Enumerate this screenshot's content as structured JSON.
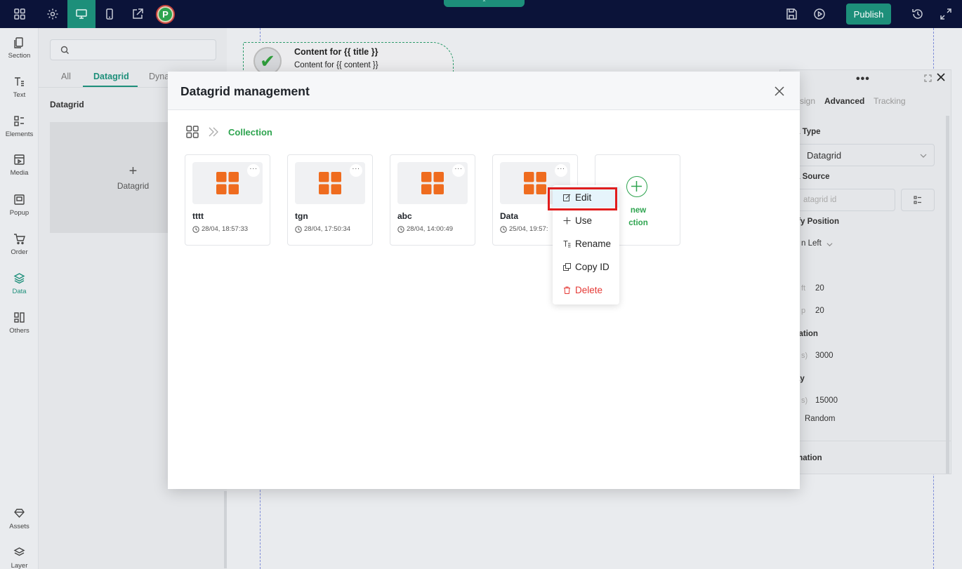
{
  "topbar": {
    "avatar_letter": "P",
    "publish_label": "Publish",
    "icons": [
      "apps-grid-icon",
      "gear-icon",
      "monitor-icon",
      "mobile-icon",
      "share-icon",
      "save-icon",
      "play-icon",
      "history-icon",
      "fullscreen-icon"
    ]
  },
  "leftnav": {
    "items": [
      {
        "label": "Section",
        "icon": "section-icon"
      },
      {
        "label": "Text",
        "icon": "text-icon"
      },
      {
        "label": "Elements",
        "icon": "elements-icon"
      },
      {
        "label": "Media",
        "icon": "media-icon"
      },
      {
        "label": "Popup",
        "icon": "popup-icon"
      },
      {
        "label": "Order",
        "icon": "cart-icon"
      },
      {
        "label": "Data",
        "icon": "layers-icon"
      },
      {
        "label": "Others",
        "icon": "others-icon"
      },
      {
        "label": "Assets",
        "icon": "diamond-icon"
      },
      {
        "label": "Layer",
        "icon": "layer-icon"
      }
    ]
  },
  "panel": {
    "tabs": [
      "All",
      "Datagrid",
      "Dyna"
    ],
    "active_tab": "Datagrid",
    "section_title": "Datagrid",
    "add_plus": "+",
    "add_label": "Datagrid"
  },
  "canvas": {
    "title": "Content for {{ title }}",
    "content": "Content for {{ content }}"
  },
  "settings": {
    "tabs": [
      "sign",
      "Advanced",
      "Tracking"
    ],
    "data_type_label": "a Type",
    "data_type_value": "Datagrid",
    "data_source_label": "a Source",
    "data_source_placeholder": "atagrid id",
    "position_label": "ify Position",
    "position_value": "n Left",
    "spacing_label": "s",
    "left_label": "ft",
    "left_value": "20",
    "top_label": "p",
    "top_value": "20",
    "duration_label": "ration",
    "duration_sub": "s)",
    "duration_value": "3000",
    "delay_label": "ay",
    "delay_sub": "s)",
    "delay_value": "15000",
    "random_label": "Random",
    "animation_label": "mation"
  },
  "modal": {
    "title": "Datagrid management",
    "breadcrumb_current": "Collection",
    "collections": [
      {
        "name": "tttt",
        "time": "28/04, 18:57:33"
      },
      {
        "name": "tgn",
        "time": "28/04, 17:50:34"
      },
      {
        "name": "abc",
        "time": "28/04, 14:00:49"
      },
      {
        "name": "Data",
        "time": "25/04, 19:57:"
      }
    ],
    "more_label": "···",
    "new_collection_line1": "new",
    "new_collection_line2": "ction",
    "accent_color": "#2ea44f",
    "tile_color": "#ef6c1f"
  },
  "context_menu": {
    "items": [
      {
        "label": "Edit",
        "icon": "edit-icon"
      },
      {
        "label": "Use",
        "icon": "plus-icon"
      },
      {
        "label": "Rename",
        "icon": "rename-icon"
      },
      {
        "label": "Copy ID",
        "icon": "copy-icon"
      },
      {
        "label": "Delete",
        "icon": "trash-icon"
      }
    ]
  }
}
